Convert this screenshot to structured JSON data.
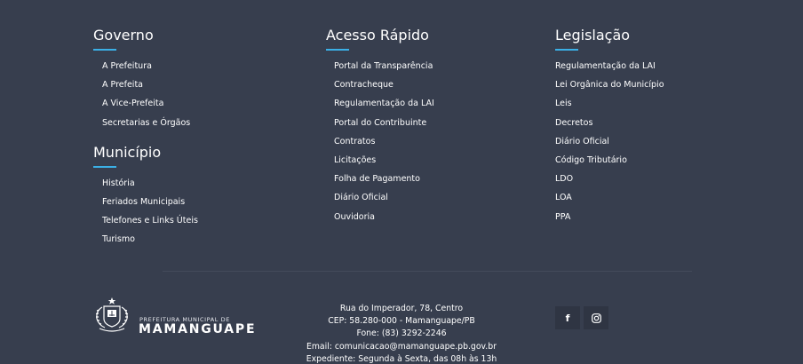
{
  "governo": {
    "title": "Governo",
    "items": [
      "A Prefeitura",
      "A Prefeita",
      "A Vice-Prefeita",
      "Secretarias e Órgãos"
    ]
  },
  "municipio": {
    "title": "Município",
    "items": [
      "História",
      "Feriados Municipais",
      "Telefones e Links Úteis",
      "Turismo"
    ]
  },
  "acesso_rapido": {
    "title": "Acesso Rápido",
    "items": [
      "Portal da Transparência",
      "Contracheque",
      "Regulamentação da LAI",
      "Portal do Contribuinte",
      "Contratos",
      "Licitações",
      "Folha de Pagamento",
      "Diário Oficial",
      "Ouvidoria"
    ]
  },
  "legislacao": {
    "title": "Legislação",
    "items": [
      "Regulamentação da LAI",
      "Lei Orgânica do Município",
      "Leis",
      "Decretos",
      "Diário Oficial",
      "Código Tributário",
      "LDO",
      "LOA",
      "PPA"
    ]
  },
  "logo": {
    "line1": "PREFEITURA MUNICIPAL DE",
    "line2": "MAMANGUAPE"
  },
  "address": {
    "line1": "Rua do Imperador, 78, Centro",
    "line2": "CEP: 58.280-000 - Mamanguape/PB",
    "line3": "Fone: (83) 3292-2246",
    "line4": "Email: comunicacao@mamanguape.pb.gov.br",
    "line5": "Expediente: Segunda à Sexta, das 08h às 13h"
  },
  "social": {
    "facebook_glyph": "f",
    "icons": [
      "facebook-icon",
      "instagram-icon"
    ]
  },
  "colors": {
    "background": "#373e4e",
    "accent": "#3bb0e6",
    "social_button": "#2f3543"
  }
}
